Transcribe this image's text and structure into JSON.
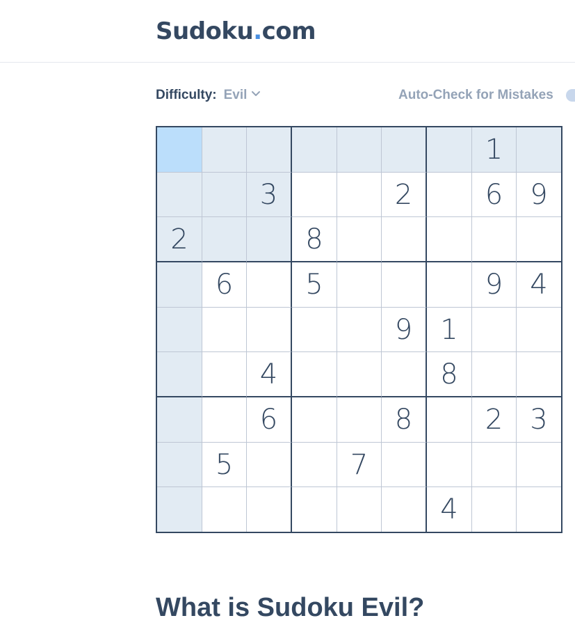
{
  "header": {
    "logo_name": "Sudoku",
    "logo_dot": ".",
    "logo_suffix": "com"
  },
  "controls": {
    "difficulty_label": "Difficulty:",
    "difficulty_value": "Evil",
    "autocheck_label": "Auto-Check for Mistakes",
    "autocheck_on": false
  },
  "board": {
    "rows": [
      [
        "",
        "",
        "",
        "",
        "",
        "",
        "",
        "1",
        ""
      ],
      [
        "",
        "",
        "3",
        "",
        "",
        "2",
        "",
        "6",
        "9"
      ],
      [
        "2",
        "",
        "",
        "8",
        "",
        "",
        "",
        "",
        ""
      ],
      [
        "",
        "6",
        "",
        "5",
        "",
        "",
        "",
        "9",
        "4"
      ],
      [
        "",
        "",
        "",
        "",
        "",
        "9",
        "1",
        "",
        ""
      ],
      [
        "",
        "",
        "4",
        "",
        "",
        "",
        "8",
        "",
        ""
      ],
      [
        "",
        "",
        "6",
        "",
        "",
        "8",
        "",
        "2",
        "3"
      ],
      [
        "",
        "5",
        "",
        "",
        "7",
        "",
        "",
        "",
        ""
      ],
      [
        "",
        "",
        "",
        "",
        "",
        "",
        "4",
        "",
        ""
      ]
    ],
    "selected": {
      "row": 0,
      "col": 0
    }
  },
  "article": {
    "heading": "What is Sudoku Evil?"
  },
  "colors": {
    "text": "#344861",
    "accent": "#4a90e2",
    "muted": "#94a3b7",
    "highlight": "#e2ebf3",
    "selected": "#bbdefb"
  },
  "icons": {
    "difficulty_dropdown": "chevron-down-icon"
  }
}
